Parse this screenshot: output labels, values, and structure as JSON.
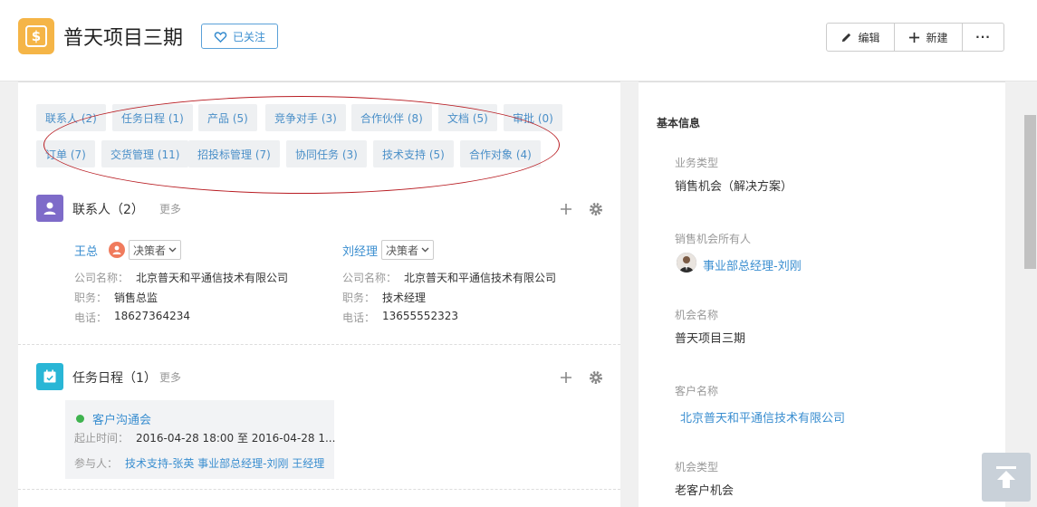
{
  "header": {
    "title": "普天项目三期",
    "follow_label": "已关注",
    "edit_label": "编辑",
    "new_label": "新建",
    "more_label": "···"
  },
  "tags": [
    "联系人 (2)",
    "任务日程 (1)",
    "产品 (5)",
    "竞争对手 (3)",
    "合作伙伴 (8)",
    "文档 (5)",
    "审批 (0)",
    "订单 (7)",
    "交货管理 (11)",
    "招投标管理 (7)",
    "协同任务 (3)",
    "技术支持 (5)",
    "合作对象 (4)"
  ],
  "contacts_section": {
    "title": "联系人（2）",
    "more": "更多",
    "contacts": [
      {
        "name": "王总",
        "role": "决策者",
        "company_label": "公司名称：",
        "company": "北京普天和平通信技术有限公司",
        "position_label": "职务：",
        "position": "销售总监",
        "phone_label": "电话：",
        "phone": "18627364234"
      },
      {
        "name": "刘经理",
        "role": "决策者",
        "company_label": "公司名称：",
        "company": "北京普天和平通信技术有限公司",
        "position_label": "职务：",
        "position": "技术经理",
        "phone_label": "电话：",
        "phone": "13655552323"
      }
    ]
  },
  "tasks_section": {
    "title": "任务日程（1）",
    "more": "更多",
    "task": {
      "title": "客户沟通会",
      "time_label": "起止时间：",
      "time": "2016-04-28 18:00 至 2016-04-28 1...",
      "participants_label": "参与人：",
      "participants": "技术支持-张英 事业部总经理-刘刚 王经理"
    }
  },
  "basic_info": {
    "heading": "基本信息",
    "business_type_label": "业务类型",
    "business_type": "销售机会（解决方案）",
    "owner_label": "销售机会所有人",
    "owner": "事业部总经理-刘刚",
    "opportunity_name_label": "机会名称",
    "opportunity_name": "普天项目三期",
    "customer_label": "客户名称",
    "customer": "北京普天和平通信技术有限公司",
    "opportunity_type_label": "机会类型",
    "opportunity_type": "老客户机会"
  },
  "colors": {
    "accent": "#3a8ed0",
    "app_icon": "#f5b547",
    "contacts_icon": "#7e6bc9",
    "tasks_icon": "#29b6d6",
    "annotation_ellipse": "#b81c22"
  }
}
